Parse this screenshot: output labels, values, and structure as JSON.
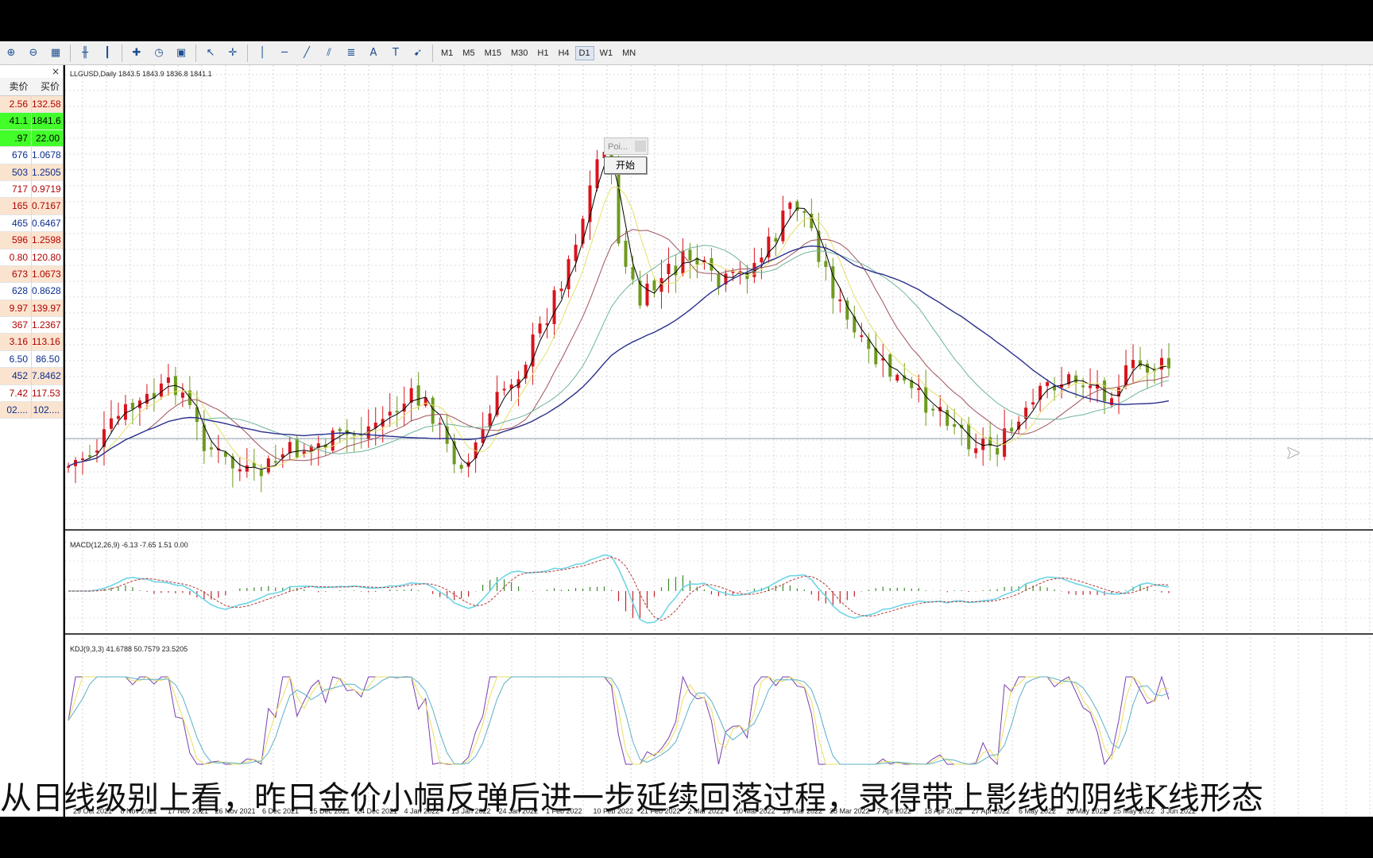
{
  "toolbar": {
    "icons": [
      "zoom-in-icon",
      "zoom-out-icon",
      "tile-icon",
      "bar-chart-icon",
      "candle-chart-icon",
      "new-order-icon",
      "clock-icon",
      "templates-icon",
      "cursor-icon",
      "crosshair-icon",
      "vertical-line-icon",
      "horizontal-line-icon",
      "trendline-icon",
      "channel-icon",
      "fibonacci-icon",
      "text-icon",
      "text-label-icon",
      "arrow-icon"
    ],
    "timeframes": [
      "M1",
      "M5",
      "M15",
      "M30",
      "H1",
      "H4",
      "D1",
      "W1",
      "MN"
    ],
    "active_timeframe": "D1"
  },
  "market_watch": {
    "close_symbol": "×",
    "col_bid": "卖价",
    "col_ask": "买价",
    "rows": [
      {
        "bid": "2.56",
        "ask": "132.58",
        "dir": "up"
      },
      {
        "bid": "41.1",
        "ask": "1841.6",
        "dir": "hl"
      },
      {
        "bid": ".97",
        "ask": "22.00",
        "dir": "hl"
      },
      {
        "bid": "676",
        "ask": "1.0678",
        "dir": "down"
      },
      {
        "bid": "503",
        "ask": "1.2505",
        "dir": "down"
      },
      {
        "bid": "717",
        "ask": "0.9719",
        "dir": "up"
      },
      {
        "bid": "165",
        "ask": "0.7167",
        "dir": "up"
      },
      {
        "bid": "465",
        "ask": "0.6467",
        "dir": "down"
      },
      {
        "bid": "596",
        "ask": "1.2598",
        "dir": "up"
      },
      {
        "bid": "0.80",
        "ask": "120.80",
        "dir": "up"
      },
      {
        "bid": "673",
        "ask": "1.0673",
        "dir": "up"
      },
      {
        "bid": "628",
        "ask": "0.8628",
        "dir": "down"
      },
      {
        "bid": "9.97",
        "ask": "139.97",
        "dir": "up"
      },
      {
        "bid": "367",
        "ask": "1.2367",
        "dir": "up"
      },
      {
        "bid": "3.16",
        "ask": "113.16",
        "dir": "up"
      },
      {
        "bid": "6.50",
        "ask": "86.50",
        "dir": "down"
      },
      {
        "bid": "452",
        "ask": "7.8462",
        "dir": "down"
      },
      {
        "bid": "7.42",
        "ask": "117.53",
        "dir": "up"
      },
      {
        "bid": "02....",
        "ask": "102....",
        "dir": "down"
      }
    ]
  },
  "chart": {
    "symbol_label": "LLGUSD,Daily  1843.5 1843.9 1836.8 1841.1",
    "macd_label": "MACD(12,26,9) -6.13 -7.65 1.51 0.00",
    "kdj_label": "KDJ(9,3,3) 41.6788 50.7579 23.5205",
    "date_labels": [
      "29 Oct 2021",
      "8 Nov 2021",
      "17 Nov 2021",
      "26 Nov 2021",
      "6 Dec 2021",
      "15 Dec 2021",
      "24 Dec 2021",
      "4 Jan 2022",
      "13 Jan 2022",
      "24 Jan 2022",
      "1 Feb 2022",
      "10 Feb 2022",
      "21 Feb 2022",
      "2 Mar 2022",
      "10 Mar 2022",
      "19 Mar 2022",
      "28 Mar 2022",
      "7 Apr 2022",
      "18 Apr 2022",
      "27 Apr 2022",
      "6 May 2022",
      "16 May 2022",
      "25 May 2022",
      "3 Jun 2022"
    ],
    "up_color": "#d8141c",
    "down_color": "#6e9a1e"
  },
  "panel": {
    "poi_text": "Poi...",
    "start_button": "开始"
  },
  "subtitle": "从日线级别上看，昨日金价小幅反弹后进一步延续回落过程，录得带上影线的阴线K线形态"
}
